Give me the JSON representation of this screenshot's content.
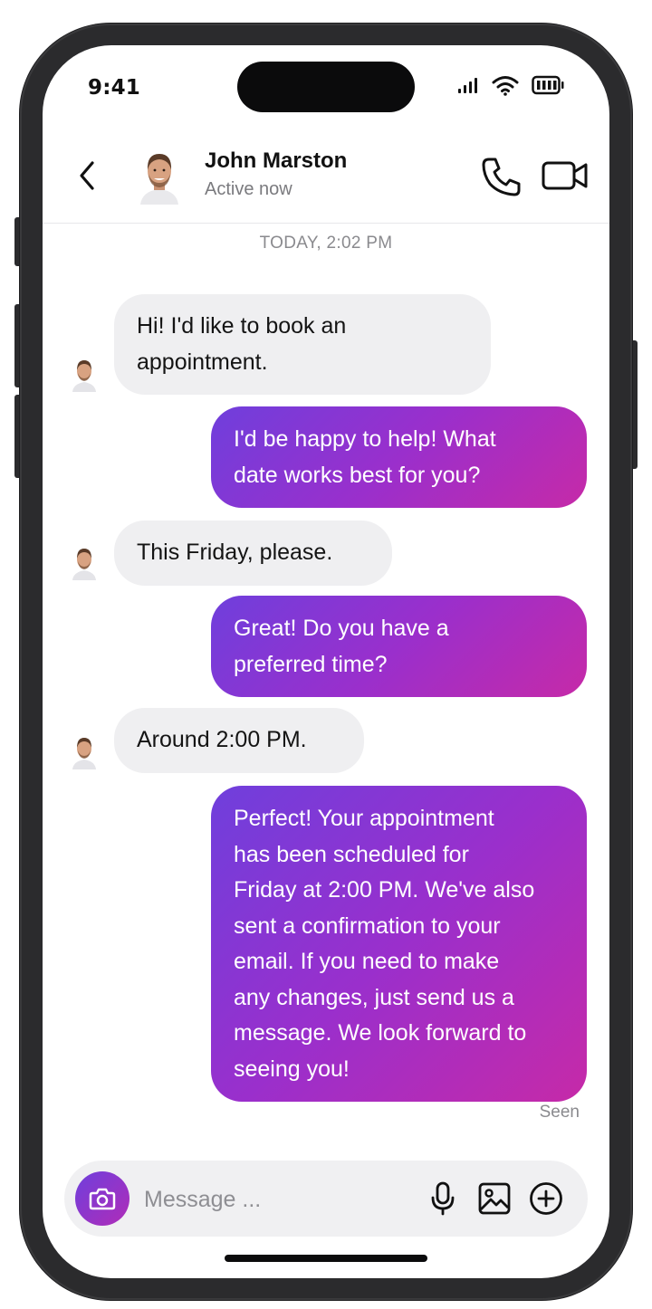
{
  "status_bar": {
    "time": "9:41"
  },
  "header": {
    "back_icon": "chevron-left-icon",
    "contact_name": "John Marston",
    "contact_status": "Active now",
    "call_icon": "phone-icon",
    "video_icon": "video-camera-icon"
  },
  "conversation": {
    "timestamp": "TODAY, 2:02 PM",
    "messages": [
      {
        "sender": "contact",
        "lines": [
          "Hi! I'd like to book an",
          "appointment."
        ]
      },
      {
        "sender": "me",
        "lines": [
          "I'd be happy to help! What",
          "date works best for you?"
        ]
      },
      {
        "sender": "contact",
        "lines": [
          "This Friday, please."
        ]
      },
      {
        "sender": "me",
        "lines": [
          "Great! Do you have a",
          "preferred time?"
        ]
      },
      {
        "sender": "contact",
        "lines": [
          "Around 2:00 PM."
        ]
      },
      {
        "sender": "me",
        "lines": [
          "Perfect! Your appointment",
          "has been scheduled for",
          "Friday at 2:00 PM. We've also",
          "sent a confirmation to your",
          "email. If you need to make",
          "any changes, just send us a",
          "message. We look forward to",
          "seeing you!"
        ]
      }
    ],
    "seen_label": "Seen"
  },
  "composer": {
    "camera_icon": "camera-icon",
    "placeholder": "Message ...",
    "value": "",
    "mic_icon": "microphone-icon",
    "gallery_icon": "image-icon",
    "add_icon": "plus-circle-icon"
  },
  "colors": {
    "outgoing_start": "#6f3fdc",
    "outgoing_end": "#c62aa8",
    "incoming_bg": "#efeff1",
    "frame": "#2b2b2d"
  }
}
